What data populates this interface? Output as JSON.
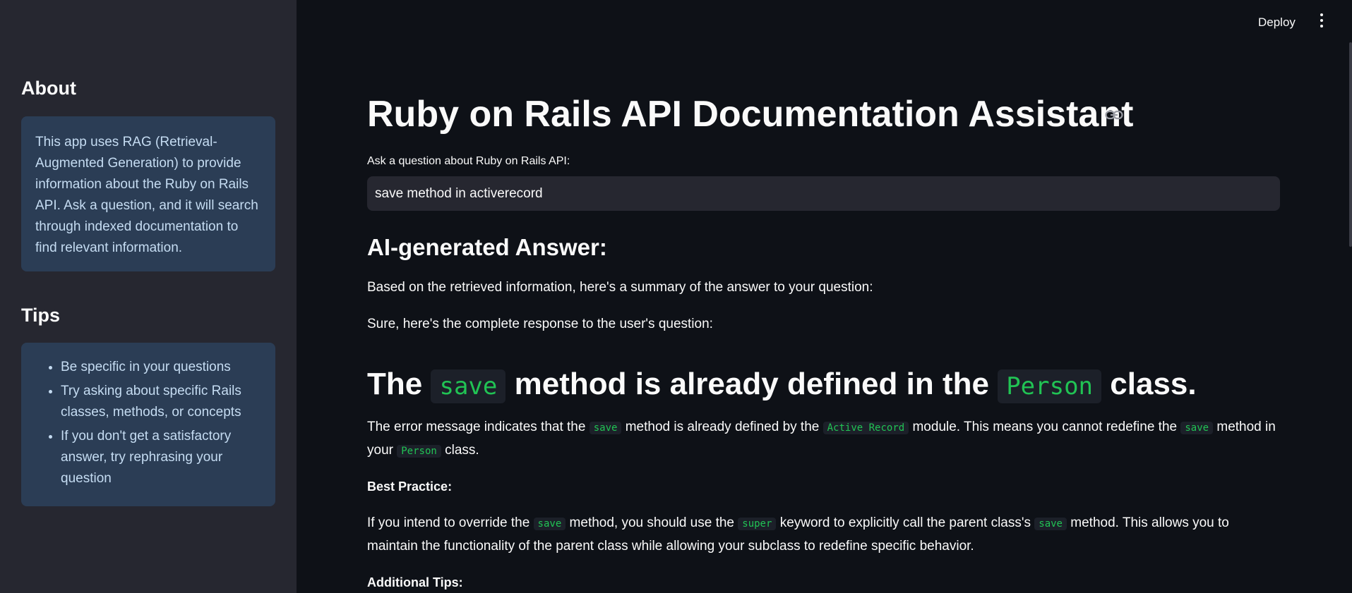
{
  "sidebar": {
    "about_heading": "About",
    "about_text": "This app uses RAG (Retrieval-Augmented Generation) to provide information about the Ruby on Rails API. Ask a question, and it will search through indexed documentation to find relevant information.",
    "tips_heading": "Tips",
    "tips": [
      "Be specific in your questions",
      "Try asking about specific Rails classes, methods, or concepts",
      "If you don't get a satisfactory answer, try rephrasing your question"
    ]
  },
  "topbar": {
    "deploy_label": "Deploy",
    "menu_icon": "kebab-menu-icon"
  },
  "main": {
    "title": "Ruby on Rails API Documentation Assistant",
    "link_icon": "link-icon",
    "input_label": "Ask a question about Ruby on Rails API:",
    "input_value": "save method in activerecord",
    "answer_heading": "AI-generated Answer:",
    "summary_intro": "Based on the retrieved information, here's a summary of the answer to your question:",
    "response_intro": "Sure, here's the complete response to the user's question:",
    "heading": {
      "part1": "The",
      "code1": "save",
      "part2": "method is already defined in the",
      "code2": "Person",
      "part3": "class."
    },
    "error_para": {
      "t1": "The error message indicates that the",
      "c1": "save",
      "t2": "method is already defined by the",
      "c2": "Active Record",
      "t3": "module. This means you cannot redefine the",
      "c3": "save",
      "t4": "method in your",
      "c4": "Person",
      "t5": "class."
    },
    "best_practice_label": "Best Practice:",
    "best_practice_para": {
      "t1": "If you intend to override the",
      "c1": "save",
      "t2": "method, you should use the",
      "c2": "super",
      "t3": "keyword to explicitly call the parent class's",
      "c3": "save",
      "t4": "method. This allows you to maintain the functionality of the parent class while allowing your subclass to redefine specific behavior."
    },
    "additional_tips_label": "Additional Tips:"
  },
  "colors": {
    "background": "#0e1117",
    "sidebar": "#262730",
    "info_box": "#2b3d55",
    "info_text": "#c5dcf2",
    "code_green": "#21c354"
  }
}
